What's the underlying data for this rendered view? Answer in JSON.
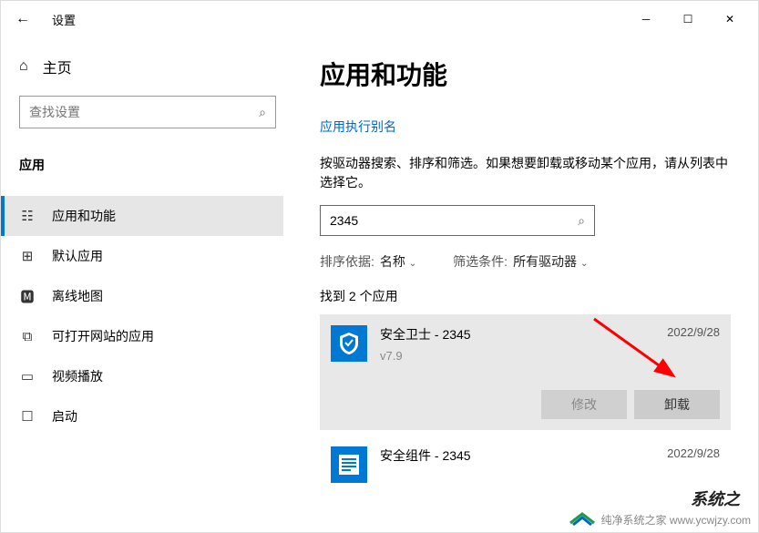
{
  "window": {
    "title": "设置"
  },
  "sidebar": {
    "home": "主页",
    "search_placeholder": "查找设置",
    "category": "应用",
    "items": [
      {
        "label": "应用和功能"
      },
      {
        "label": "默认应用"
      },
      {
        "label": "离线地图"
      },
      {
        "label": "可打开网站的应用"
      },
      {
        "label": "视频播放"
      },
      {
        "label": "启动"
      }
    ]
  },
  "content": {
    "heading": "应用和功能",
    "alias_link": "应用执行别名",
    "description": "按驱动器搜索、排序和筛选。如果想要卸载或移动某个应用，请从列表中选择它。",
    "search_value": "2345",
    "sort": {
      "label": "排序依据:",
      "value": "名称"
    },
    "filter": {
      "label": "筛选条件:",
      "value": "所有驱动器"
    },
    "found": "找到 2 个应用",
    "apps": [
      {
        "name": "安全卫士 - 2345",
        "version": "v7.9",
        "date": "2022/9/28",
        "modify": "修改",
        "uninstall": "卸载"
      },
      {
        "name": "安全组件 - 2345",
        "date": "2022/9/28"
      }
    ]
  },
  "watermark": {
    "partial": "系统之",
    "url": "纯净系统之家  www.ycwjzy.com"
  }
}
